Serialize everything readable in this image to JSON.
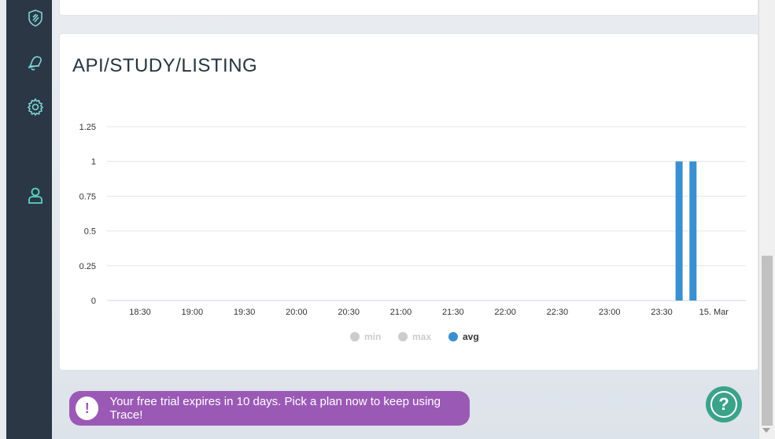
{
  "sidebar": {
    "items": [
      {
        "icon": "shield-icon"
      },
      {
        "icon": "bell-icon"
      },
      {
        "icon": "gear-icon"
      },
      {
        "icon": "user-icon"
      }
    ]
  },
  "card": {
    "title": "API/STUDY/LISTING"
  },
  "chart_data": {
    "type": "bar",
    "title": "",
    "xlabel": "",
    "ylabel": "",
    "x_ticks": [
      "18:30",
      "19:00",
      "19:30",
      "20:00",
      "20:30",
      "21:00",
      "21:30",
      "22:00",
      "22:30",
      "23:00",
      "23:30",
      "15. Mar"
    ],
    "y_ticks": [
      "0",
      "0.25",
      "0.5",
      "0.75",
      "1",
      "1.25"
    ],
    "ylim": [
      0,
      1.25
    ],
    "grid": true,
    "legend_placement": "bottom-center",
    "series": [
      {
        "name": "min",
        "color": "#cccccc",
        "visible": false,
        "points": []
      },
      {
        "name": "max",
        "color": "#cccccc",
        "visible": false,
        "points": []
      },
      {
        "name": "avg",
        "color": "#3b8fd0",
        "visible": true,
        "points": [
          {
            "x": "23:40",
            "y": 1
          },
          {
            "x": "23:48",
            "y": 1
          }
        ]
      }
    ]
  },
  "trial_banner": {
    "icon": "!",
    "text": "Your free trial expires in 10 days. Pick a plan now to keep using Trace!"
  },
  "help": {
    "icon": "?"
  }
}
